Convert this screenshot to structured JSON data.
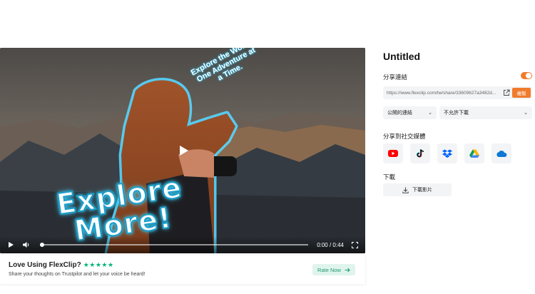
{
  "video": {
    "caption_top": "Explore the World,\nOne Adventure at\na Time.",
    "caption_main": "Explore\nMore!",
    "time": "0:00 / 0:44",
    "progress": 0.0
  },
  "rating": {
    "title": "Love Using FlexClip?",
    "stars": "★★★★★",
    "subtitle": "Share your thoughts on Trustpilot and let your voice be heard!",
    "button": "Rate Now"
  },
  "panel": {
    "title": "Untitled",
    "share_link_label": "分享連結",
    "share_link_enabled": true,
    "link_value": "https://www.flexclip.com/tw/share/33609627a3482d...",
    "copy_button": "複製",
    "visibility": "公開的連結",
    "download_permission": "不允許下載",
    "share_social_label": "分享到社交媒體",
    "social_icons": [
      "youtube-icon",
      "tiktok-icon",
      "dropbox-icon",
      "google-drive-icon",
      "onedrive-icon"
    ],
    "download_label": "下載",
    "download_button": "下載影片"
  },
  "colors": {
    "accent": "#f07b2c",
    "trustpilot": "#00b67a",
    "youtube": "#ff0000",
    "dropbox": "#0061fe",
    "onedrive": "#0f78d4"
  }
}
